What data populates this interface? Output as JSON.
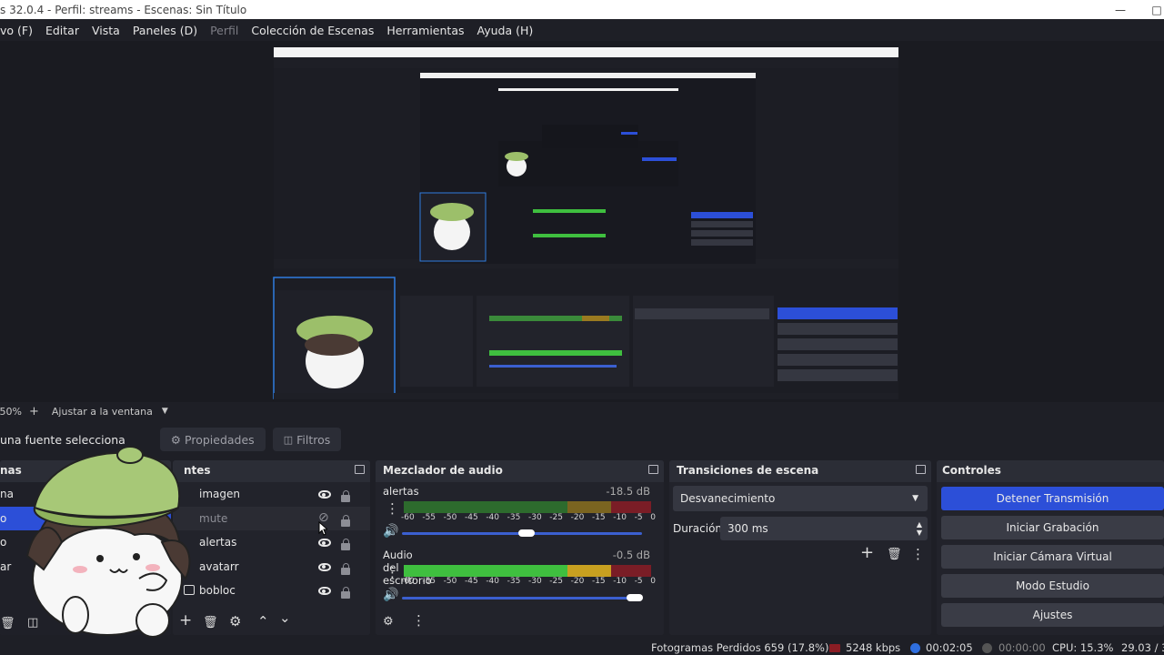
{
  "window": {
    "title": "s 32.0.4 - Perfil: streams - Escenas: Sin Título"
  },
  "menu": {
    "items": [
      "vo (F)",
      "Editar",
      "Vista",
      "Paneles (D)",
      "Perfil",
      "Colección de Escenas",
      "Herramientas",
      "Ayuda (H)"
    ]
  },
  "zoom": {
    "percent": "50%",
    "plus": "+",
    "fit_label": "Ajustar a la ventana"
  },
  "source_bar": {
    "selection_label": "una fuente selecciona",
    "properties": "Propiedades",
    "filters": "Filtros"
  },
  "scenes": {
    "title": "nas",
    "items": [
      "na",
      "o",
      "o",
      "ar"
    ]
  },
  "sources": {
    "title": "ntes",
    "items": [
      {
        "name": "imagen",
        "visible": true
      },
      {
        "name": "mute",
        "visible": false
      },
      {
        "name": "alertas",
        "visible": true
      },
      {
        "name": "avatarr",
        "visible": true
      },
      {
        "name": "bobloc",
        "visible": true
      }
    ]
  },
  "mixer": {
    "title": "Mezclador de audio",
    "channels": [
      {
        "name": "alertas",
        "db": "-18.5 dB",
        "level": 0.0,
        "volume": 0.52
      },
      {
        "name": "Audio del escritorio",
        "db": "-0.5 dB",
        "level": 0.64,
        "volume": 0.97
      }
    ],
    "ticks": [
      "-60",
      "-55",
      "-50",
      "-45",
      "-40",
      "-35",
      "-30",
      "-25",
      "-20",
      "-15",
      "-10",
      "-5",
      "0"
    ]
  },
  "transitions": {
    "title": "Transiciones de escena",
    "type": "Desvanecimiento",
    "duration_label": "Duración",
    "duration_value": "300 ms"
  },
  "controls": {
    "title": "Controles",
    "buttons": [
      "Detener Transmisión",
      "Iniciar Grabación",
      "Iniciar Cámara Virtual",
      "Modo Estudio",
      "Ajustes"
    ]
  },
  "status": {
    "dropped": "Fotogramas Perdidos 659 (17.8%)",
    "bitrate": "5248 kbps",
    "stream_time": "00:02:05",
    "rec_time": "00:00:00",
    "cpu": "CPU: 15.3%",
    "fps": "29.03 / 3"
  },
  "colors": {
    "accent": "#2c4fd8",
    "meter_green": "#3fbf3f",
    "meter_yellow": "#c8a020",
    "meter_red": "#c0202e"
  }
}
